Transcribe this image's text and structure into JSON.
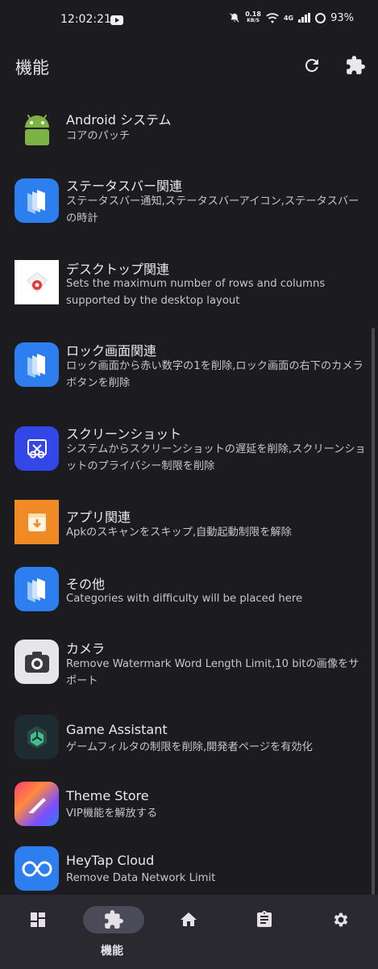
{
  "status_bar": {
    "time": "12:02:21",
    "net_speed_value": "0.18",
    "net_speed_unit": "KB/S",
    "network": "4G",
    "battery": "93%"
  },
  "app_bar": {
    "title": "機能",
    "refresh_icon": "refresh-icon",
    "plugin_icon": "puzzle-icon"
  },
  "items": [
    {
      "title": "Android システム",
      "desc": "コアのパッチ",
      "icon": "android-icon"
    },
    {
      "title": "ステータスバー関連",
      "desc": "ステータスバー通知,ステータスバーアイコン,ステータスバーの時計",
      "icon": "blue-cards-icon"
    },
    {
      "title": "デスクトップ関連",
      "desc": "Sets the maximum number of rows and columns supported by the desktop layout",
      "icon": "launcher-icon"
    },
    {
      "title": "ロック画面関連",
      "desc": "ロック画面から赤い数字の1を削除,ロック画面の右下のカメラボタンを削除",
      "icon": "blue-cards-icon"
    },
    {
      "title": "スクリーンショット",
      "desc": "システムからスクリーンショットの遅延を削除,スクリーンショットのプライバシー制限を削除",
      "icon": "screenshot-icon"
    },
    {
      "title": "アプリ関連",
      "desc": "Apkのスキャンをスキップ,自動起動制限を解除",
      "icon": "app-install-icon"
    },
    {
      "title": "その他",
      "desc": "Categories with difficulty will be placed here",
      "icon": "blue-cards-icon"
    },
    {
      "title": "カメラ",
      "desc": "Remove Watermark Word Length Limit,10 bitの画像をサポート",
      "icon": "camera-icon"
    },
    {
      "title": "Game Assistant",
      "desc": "ゲームフィルタの制限を削除,開発者ページを有効化",
      "icon": "game-assistant-icon"
    },
    {
      "title": "Theme Store",
      "desc": "VIP機能を解放する",
      "icon": "theme-store-icon"
    },
    {
      "title": "HeyTap Cloud",
      "desc": "Remove Data Network Limit",
      "icon": "cloud-icon"
    }
  ],
  "bottom_nav": {
    "items": [
      {
        "icon": "dashboard-icon",
        "label": ""
      },
      {
        "icon": "puzzle-icon",
        "label": "機能",
        "active": true
      },
      {
        "icon": "home-icon",
        "label": ""
      },
      {
        "icon": "clipboard-icon",
        "label": ""
      },
      {
        "icon": "gear-icon",
        "label": ""
      }
    ]
  },
  "colors": {
    "background": "#1c1b20",
    "nav_background": "#2a2930",
    "nav_active_pill": "#4b4a58",
    "android_green": "#7cb342",
    "blue_icon": "#2d7ff0",
    "orange_icon": "#f08a24",
    "indigo_icon": "#3346e6"
  }
}
